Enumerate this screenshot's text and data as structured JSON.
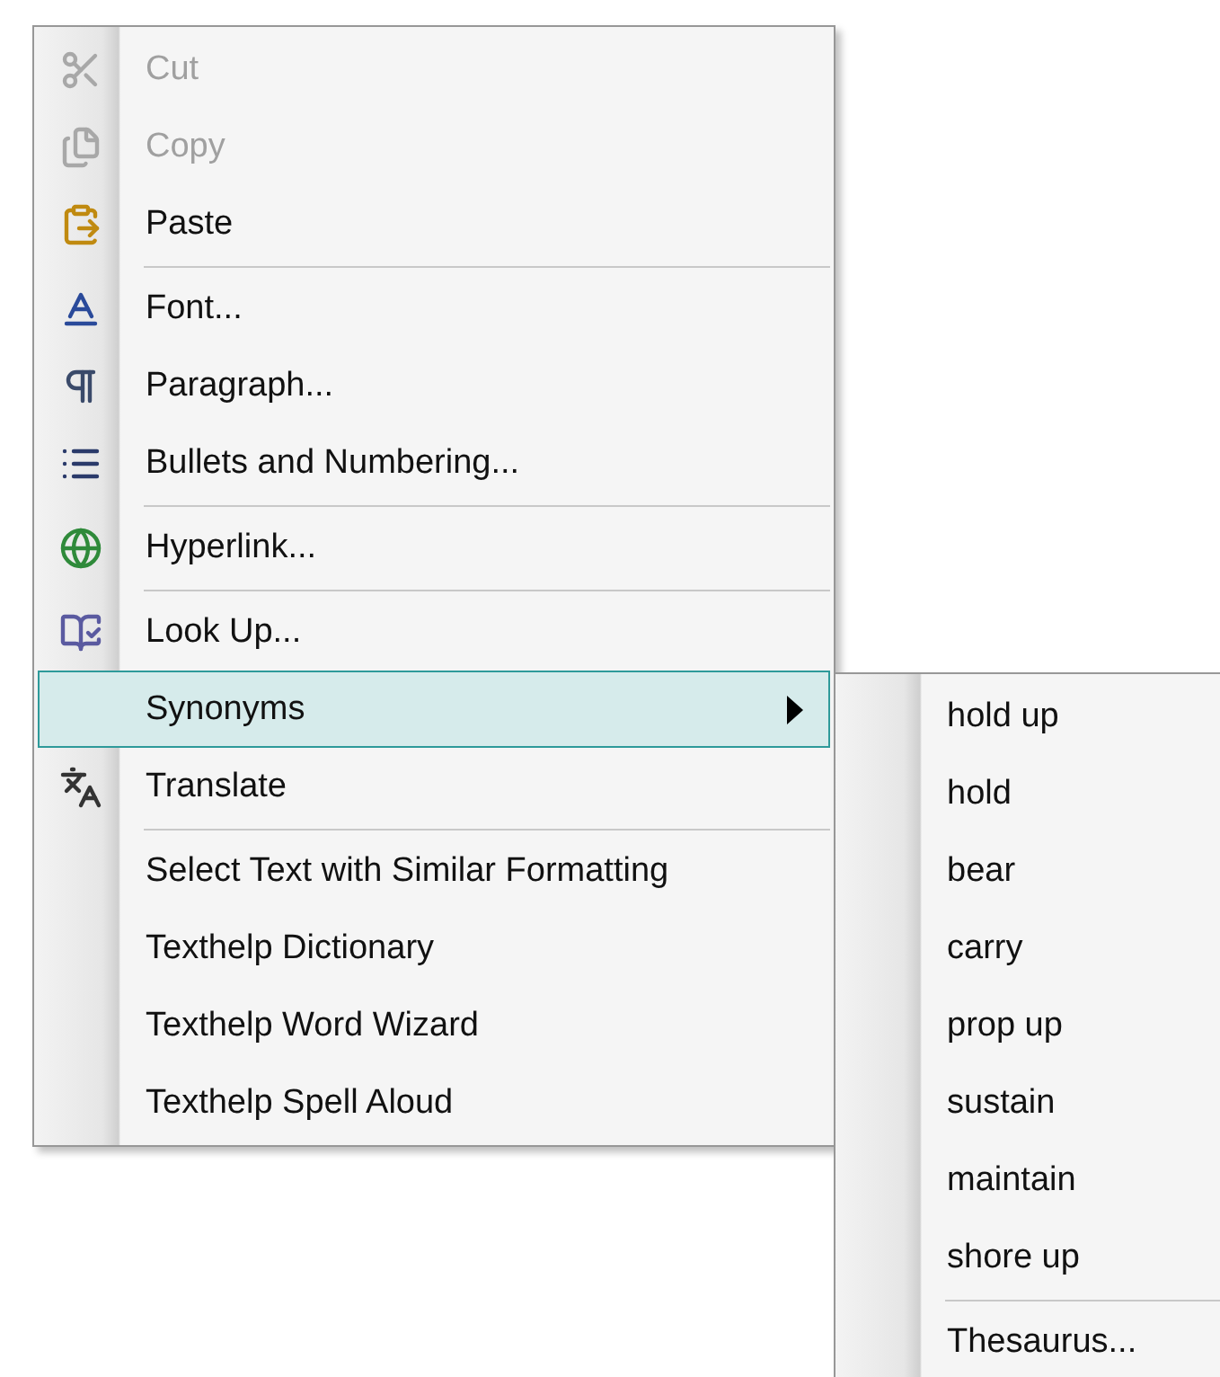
{
  "context_menu": {
    "items": [
      {
        "kind": "item",
        "label": "Cut",
        "disabled": true,
        "selected": false,
        "has_submenu": false
      },
      {
        "kind": "item",
        "label": "Copy",
        "disabled": true,
        "selected": false,
        "has_submenu": false
      },
      {
        "kind": "item",
        "label": "Paste",
        "disabled": false,
        "selected": false,
        "has_submenu": false
      },
      {
        "kind": "separator"
      },
      {
        "kind": "item",
        "label": "Font...",
        "disabled": false,
        "selected": false,
        "has_submenu": false
      },
      {
        "kind": "item",
        "label": "Paragraph...",
        "disabled": false,
        "selected": false,
        "has_submenu": false
      },
      {
        "kind": "item",
        "label": "Bullets and Numbering...",
        "disabled": false,
        "selected": false,
        "has_submenu": false
      },
      {
        "kind": "separator"
      },
      {
        "kind": "item",
        "label": "Hyperlink...",
        "disabled": false,
        "selected": false,
        "has_submenu": false
      },
      {
        "kind": "separator"
      },
      {
        "kind": "item",
        "label": "Look Up...",
        "disabled": false,
        "selected": false,
        "has_submenu": false
      },
      {
        "kind": "item",
        "label": "Synonyms",
        "disabled": false,
        "selected": true,
        "has_submenu": true
      },
      {
        "kind": "item",
        "label": "Translate",
        "disabled": false,
        "selected": false,
        "has_submenu": false
      },
      {
        "kind": "separator"
      },
      {
        "kind": "item",
        "label": "Select Text with Similar Formatting",
        "disabled": false,
        "selected": false,
        "has_submenu": false
      },
      {
        "kind": "item",
        "label": "Texthelp Dictionary",
        "disabled": false,
        "selected": false,
        "has_submenu": false
      },
      {
        "kind": "item",
        "label": "Texthelp Word Wizard",
        "disabled": false,
        "selected": false,
        "has_submenu": false
      },
      {
        "kind": "item",
        "label": "Texthelp Spell Aloud",
        "disabled": false,
        "selected": false,
        "has_submenu": false
      }
    ]
  },
  "synonyms_submenu": {
    "items": [
      {
        "kind": "item",
        "label": "hold up"
      },
      {
        "kind": "item",
        "label": "hold"
      },
      {
        "kind": "item",
        "label": "bear"
      },
      {
        "kind": "item",
        "label": "carry"
      },
      {
        "kind": "item",
        "label": "prop up"
      },
      {
        "kind": "item",
        "label": "sustain"
      },
      {
        "kind": "item",
        "label": "maintain"
      },
      {
        "kind": "item",
        "label": "shore up"
      },
      {
        "kind": "separator"
      },
      {
        "kind": "item",
        "label": "Thesaurus..."
      }
    ]
  }
}
